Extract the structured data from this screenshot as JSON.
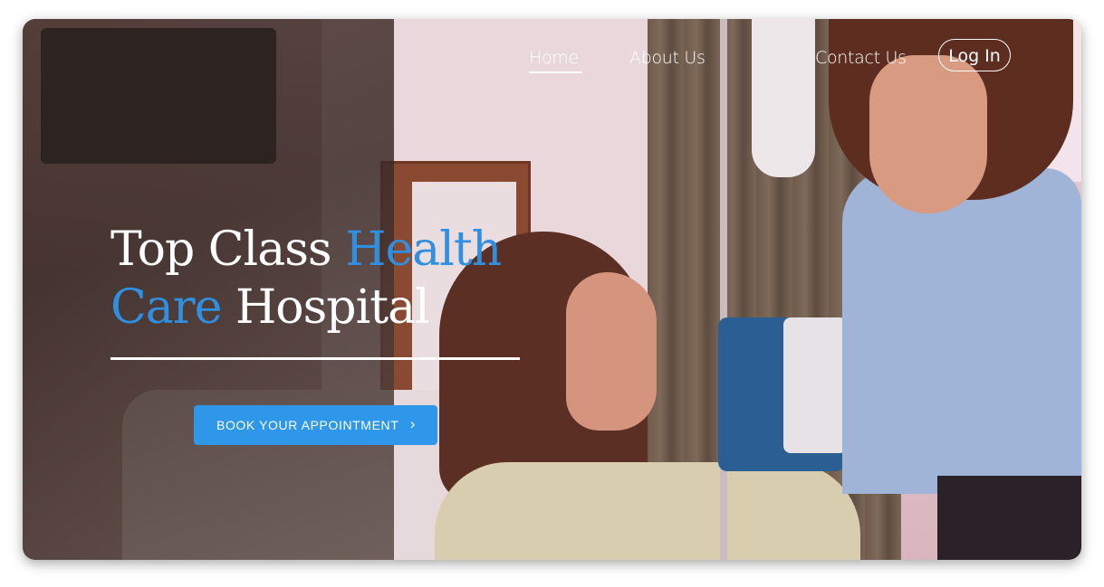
{
  "nav": {
    "home": "Home",
    "about": "About Us",
    "contact": "Contact Us",
    "login": "Log In"
  },
  "hero": {
    "title_part1": "Top Class ",
    "title_part2": "Health",
    "title_part3": "Care",
    "title_part4": " Hospital",
    "cta_label": "BOOK YOUR APPOINTMENT",
    "cta_icon": "chevron-right-icon"
  },
  "colors": {
    "accent": "#2f8fe0",
    "button": "#2f97ea"
  }
}
